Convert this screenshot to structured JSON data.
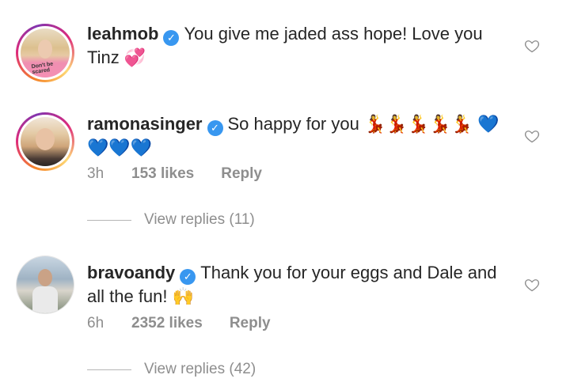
{
  "comments": [
    {
      "username": "leahmob",
      "text": "You give me jaded ass hope! Love you Tinz 💞",
      "avatar_caption": "Don't be scared"
    },
    {
      "username": "ramonasinger",
      "text": "So happy for you 💃💃💃💃💃 💙💙💙💙",
      "time": "3h",
      "likes": "153 likes",
      "reply": "Reply",
      "view_replies": "View replies (11)"
    },
    {
      "username": "bravoandy",
      "text": "Thank you for your eggs and Dale and all the fun! 🙌",
      "time": "6h",
      "likes": "2352 likes",
      "reply": "Reply",
      "view_replies": "View replies (42)"
    }
  ],
  "icons": {
    "verified": "verified-badge-icon",
    "like": "heart-outline-icon"
  },
  "colors": {
    "verified": "#3897f0",
    "secondary_text": "#8e8e8e",
    "primary_text": "#262626"
  }
}
